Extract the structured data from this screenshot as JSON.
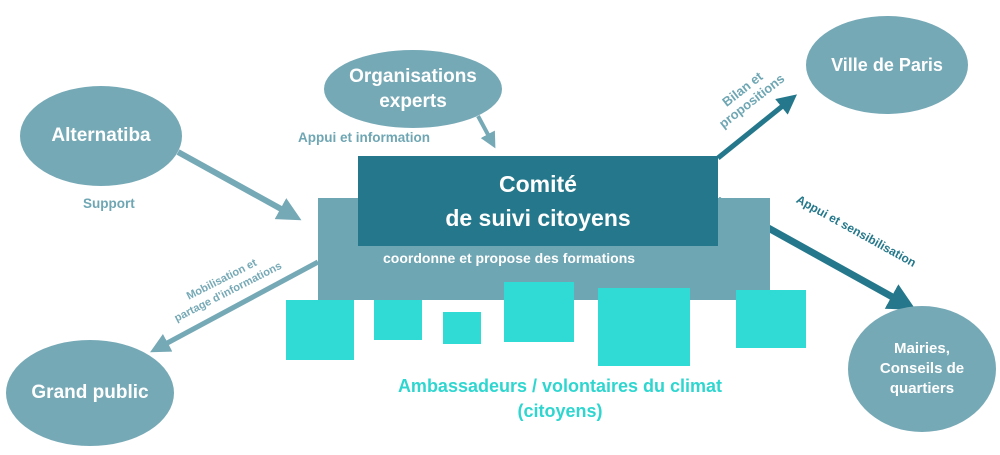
{
  "nodes": {
    "alternatiba": "Alternatiba",
    "organisations_line1": "Organisations",
    "organisations_line2": "experts",
    "ville_de_paris": "Ville de Paris",
    "grand_public": "Grand public",
    "mairies_line1": "Mairies,",
    "mairies_line2": "Conseils de",
    "mairies_line3": "quartiers"
  },
  "comite": {
    "line1": "Comité",
    "line2": "de suivi citoyens"
  },
  "panel_text": "coordonne et propose des formations",
  "edges": {
    "support": "Support",
    "appui_information": "Appui et information",
    "bilan_line1": "Bilan et",
    "bilan_line2": "propositions",
    "appui_sensibilisation": "Appui et sensibilisation",
    "mobilisation_line1": "Mobilisation et",
    "mobilisation_line2": "partage d'informations"
  },
  "ambassadeurs": {
    "line1": "Ambassadeurs / volontaires du climat",
    "line2": "(citoyens)"
  },
  "colors": {
    "ellipse": "#76a9b6",
    "panel": "#6ea6b3",
    "comite": "#25788b",
    "squares": "#2fdbd4",
    "arrow_light": "#76a9b6",
    "arrow_dark": "#25788b"
  }
}
